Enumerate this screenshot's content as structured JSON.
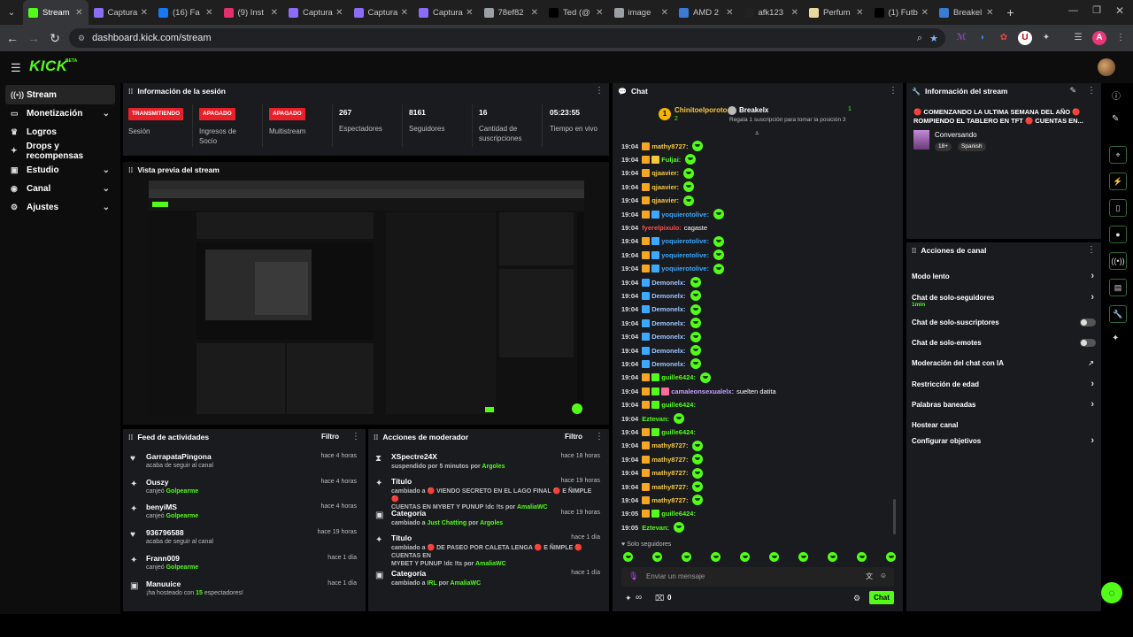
{
  "browser": {
    "tabs": [
      {
        "title": "Stream",
        "icon": "kick-icon",
        "color": "#53fc18",
        "active": true
      },
      {
        "title": "Captura",
        "icon": "capture-icon",
        "color": "#8b6cf6"
      },
      {
        "title": "(16) Fa",
        "icon": "facebook-icon",
        "color": "#1877f2"
      },
      {
        "title": "(9) Inst",
        "icon": "instagram-icon",
        "color": "#e1306c"
      },
      {
        "title": "Captura",
        "icon": "capture-icon",
        "color": "#8b6cf6"
      },
      {
        "title": "Captura",
        "icon": "capture-icon",
        "color": "#8b6cf6"
      },
      {
        "title": "Captura",
        "icon": "capture-icon",
        "color": "#8b6cf6"
      },
      {
        "title": "78ef82",
        "icon": "globe-icon",
        "color": "#9aa0a6"
      },
      {
        "title": "Ted (@",
        "icon": "x-icon",
        "color": "#000000"
      },
      {
        "title": "image",
        "icon": "globe-icon",
        "color": "#9aa0a6"
      },
      {
        "title": "AMD 2",
        "icon": "amd-icon",
        "color": "#3a7bd5"
      },
      {
        "title": "afk123",
        "icon": "tiktok-icon",
        "color": "#222222"
      },
      {
        "title": "Perfum",
        "icon": "perfume-icon",
        "color": "#e8d9a0"
      },
      {
        "title": "(1) Futb",
        "icon": "x-icon",
        "color": "#000000"
      },
      {
        "title": "Breakel",
        "icon": "translate-icon",
        "color": "#3a7bd5"
      }
    ],
    "url": "dashboard.kick.com/stream"
  },
  "brand": {
    "logo": "KICK",
    "beta": "BETA",
    "accent": "#53fc18"
  },
  "sidebar": {
    "items": [
      {
        "label": "Stream",
        "icon": "stream-icon",
        "active": true,
        "chevron": false
      },
      {
        "label": "Monetización",
        "icon": "money-icon",
        "chevron": true
      },
      {
        "label": "Logros",
        "icon": "trophy-icon",
        "chevron": false
      },
      {
        "label": "Drops y recompensas",
        "icon": "gift-icon",
        "chevron": false
      },
      {
        "label": "Estudio",
        "icon": "studio-icon",
        "chevron": true
      },
      {
        "label": "Canal",
        "icon": "channel-icon",
        "chevron": true
      },
      {
        "label": "Ajustes",
        "icon": "gear-icon",
        "chevron": true
      }
    ]
  },
  "session": {
    "title": "Información de la sesión",
    "badges": [
      "TRANSMITIENDO",
      "APAGADO",
      "APAGADO"
    ],
    "labels": [
      "Sesión",
      "Ingresos de Socio",
      "Multistream"
    ],
    "stats": [
      {
        "value": "267",
        "label": "Espectadores"
      },
      {
        "value": "8161",
        "label": "Seguidores"
      },
      {
        "value": "16",
        "label": "Cantidad de suscripciones"
      },
      {
        "value": "05:23:55",
        "label": "Tiempo en vivo"
      }
    ]
  },
  "preview": {
    "title": "Vista previa del stream"
  },
  "activity": {
    "title": "Feed de actividades",
    "filter": "Filtro",
    "items": [
      {
        "icon": "heart-icon",
        "name": "GarrapataPingona",
        "sub": "acaba de seguir al canal",
        "highlight": "",
        "time": "hace 4 horas"
      },
      {
        "icon": "gift-icon",
        "name": "Ouszy",
        "sub": "canjeó",
        "highlight": "Golpearme",
        "time": "hace 4 horas"
      },
      {
        "icon": "gift-icon",
        "name": "benyiMS",
        "sub": "canjeó",
        "highlight": "Golpearme",
        "time": "hace 4 horas"
      },
      {
        "icon": "heart-icon",
        "name": "936796588",
        "sub": "acaba de seguir al canal",
        "highlight": "",
        "time": "hace 19 horas"
      },
      {
        "icon": "gift-icon",
        "name": "Frann009",
        "sub": "canjeó",
        "highlight": "Golpearme",
        "time": "hace 1 día"
      },
      {
        "icon": "host-icon",
        "name": "Manuuice",
        "sub": "¡ha hosteado con",
        "highlight": "15",
        "sub2": "espectadores!",
        "time": "hace 1 día"
      }
    ]
  },
  "modactions": {
    "title": "Acciones de moderador",
    "filter": "Filtro",
    "items": [
      {
        "icon": "hourglass-icon",
        "name": "XSpectre24X",
        "l1": "suspendido por 5 minutos por",
        "who": "Argoles",
        "l2": "",
        "time": "hace 18 horas"
      },
      {
        "icon": "title-icon",
        "name": "Título",
        "l1": "cambiado a 🔴 VIENDO SECRETO EN EL LAGO FINAL 🔴 E ÑIMPLE 🔴",
        "l2": "CUENTAS EN MYBET Y PUNUP !dc !ts por",
        "who": "AmaliaWC",
        "time": "hace 19 horas"
      },
      {
        "icon": "category-icon",
        "name": "Categoría",
        "l1": "cambiado a",
        "who": "Just Chatting",
        "l1b": "por",
        "who2": "Argoles",
        "l2": "",
        "time": "hace 19 horas"
      },
      {
        "icon": "title-icon",
        "name": "Título",
        "l1": "cambiado a 🔴 DE PASEO POR CALETA LENGA 🔴 E ÑIMPLE 🔴 CUENTAS EN",
        "l2": "MYBET Y PUNUP !dc !ts por",
        "who": "AmaliaWC",
        "time": "hace 1 día"
      },
      {
        "icon": "category-icon",
        "name": "Categoría",
        "l1": "cambiado a",
        "who": "IRL",
        "l1b": "por",
        "who2": "AmaliaWC",
        "l2": "",
        "time": "hace 1 día"
      }
    ]
  },
  "chat": {
    "title": "Chat",
    "pinned": {
      "rank": "1",
      "user": "Chinitoelporoto",
      "count": "2",
      "target": "Breakelx",
      "target_count": "1",
      "note": "Regala 1 suscripción para tomar la posición 3"
    },
    "messages": [
      {
        "time": "19:04",
        "user": "mathy8727:",
        "color": "#f5c842",
        "badges": [
          "#f5a623"
        ],
        "text": "",
        "emote": true
      },
      {
        "time": "19:04",
        "user": "Fuljai:",
        "color": "#53fc18",
        "badges": [
          "#f5a623",
          "#f5c842"
        ],
        "text": "",
        "emote": true
      },
      {
        "time": "19:04",
        "user": "qjaavier:",
        "color": "#f5c842",
        "badges": [
          "#f5a623"
        ],
        "text": "",
        "emote": true
      },
      {
        "time": "19:04",
        "user": "qjaavier:",
        "color": "#f5c842",
        "badges": [
          "#f5a623"
        ],
        "text": "",
        "emote": true
      },
      {
        "time": "19:04",
        "user": "qjaavier:",
        "color": "#f5c842",
        "badges": [
          "#f5a623"
        ],
        "text": "",
        "emote": true
      },
      {
        "time": "19:04",
        "user": "yoquierotolive:",
        "color": "#3ba9ff",
        "badges": [
          "#f5a623",
          "#3ba9ff"
        ],
        "text": "",
        "emote": true
      },
      {
        "time": "19:04",
        "user": "fyerelpixulo:",
        "color": "#ff4d4d",
        "badges": [],
        "text": "cagaste",
        "emote": false
      },
      {
        "time": "19:04",
        "user": "yoquierotolive:",
        "color": "#3ba9ff",
        "badges": [
          "#f5a623",
          "#3ba9ff"
        ],
        "text": "",
        "emote": true
      },
      {
        "time": "19:04",
        "user": "yoquierotolive:",
        "color": "#3ba9ff",
        "badges": [
          "#f5a623",
          "#3ba9ff"
        ],
        "text": "",
        "emote": true
      },
      {
        "time": "19:04",
        "user": "yoquierotolive:",
        "color": "#3ba9ff",
        "badges": [
          "#f5a623",
          "#3ba9ff"
        ],
        "text": "",
        "emote": true
      },
      {
        "time": "19:04",
        "user": "Demonelx:",
        "color": "#9ec5ff",
        "badges": [
          "#3ba9ff"
        ],
        "text": "",
        "emote": true
      },
      {
        "time": "19:04",
        "user": "Demonelx:",
        "color": "#9ec5ff",
        "badges": [
          "#3ba9ff"
        ],
        "text": "",
        "emote": true
      },
      {
        "time": "19:04",
        "user": "Demonelx:",
        "color": "#9ec5ff",
        "badges": [
          "#3ba9ff"
        ],
        "text": "",
        "emote": true
      },
      {
        "time": "19:04",
        "user": "Demonelx:",
        "color": "#9ec5ff",
        "badges": [
          "#3ba9ff"
        ],
        "text": "",
        "emote": true
      },
      {
        "time": "19:04",
        "user": "Demonelx:",
        "color": "#9ec5ff",
        "badges": [
          "#3ba9ff"
        ],
        "text": "",
        "emote": true
      },
      {
        "time": "19:04",
        "user": "Demonelx:",
        "color": "#9ec5ff",
        "badges": [
          "#3ba9ff"
        ],
        "text": "",
        "emote": true
      },
      {
        "time": "19:04",
        "user": "Demonelx:",
        "color": "#9ec5ff",
        "badges": [
          "#3ba9ff"
        ],
        "text": "",
        "emote": true
      },
      {
        "time": "19:04",
        "user": "guille6424:",
        "color": "#53fc18",
        "badges": [
          "#f5a623",
          "#53fc18"
        ],
        "text": "",
        "emote": true
      },
      {
        "time": "19:04",
        "user": "camaleonsexualelx:",
        "color": "#c8a2ff",
        "badges": [
          "#f5a623",
          "#53fc18",
          "#ff6b9a"
        ],
        "text": "suelten datita",
        "emote": false
      },
      {
        "time": "19:04",
        "user": "guille6424:",
        "color": "#53fc18",
        "badges": [
          "#f5a623",
          "#53fc18"
        ],
        "text": "",
        "emote": false
      },
      {
        "time": "19:04",
        "user": "Eztevan:",
        "color": "#53fc18",
        "badges": [],
        "text": "",
        "emote": true
      },
      {
        "time": "19:04",
        "user": "guille6424:",
        "color": "#53fc18",
        "badges": [
          "#f5a623",
          "#53fc18"
        ],
        "text": "",
        "emote": false
      },
      {
        "time": "19:04",
        "user": "mathy8727:",
        "color": "#f5c842",
        "badges": [
          "#f5a623"
        ],
        "text": "",
        "emote": true
      },
      {
        "time": "19:04",
        "user": "mathy8727:",
        "color": "#f5c842",
        "badges": [
          "#f5a623"
        ],
        "text": "",
        "emote": true
      },
      {
        "time": "19:04",
        "user": "mathy8727:",
        "color": "#f5c842",
        "badges": [
          "#f5a623"
        ],
        "text": "",
        "emote": true
      },
      {
        "time": "19:04",
        "user": "mathy8727:",
        "color": "#f5c842",
        "badges": [
          "#f5a623"
        ],
        "text": "",
        "emote": true
      },
      {
        "time": "19:04",
        "user": "mathy8727:",
        "color": "#f5c842",
        "badges": [
          "#f5a623"
        ],
        "text": "",
        "emote": true
      },
      {
        "time": "19:05",
        "user": "guille6424:",
        "color": "#53fc18",
        "badges": [
          "#f5a623",
          "#53fc18"
        ],
        "text": "",
        "emote": false
      },
      {
        "time": "19:05",
        "user": "Eztevan:",
        "color": "#53fc18",
        "badges": [],
        "text": "",
        "emote": true
      }
    ],
    "followers_only": "Solo seguidores",
    "placeholder": "Enviar un mensaje",
    "infinity": "∞",
    "gift_count": "0",
    "send": "Chat"
  },
  "streaminfo": {
    "title": "Información del stream",
    "stream_title": "🔴 COMENZANDO LA ULTIMA SEMANA DEL AÑO 🔴 ROMPIENDO EL TABLERO EN TFT 🔴 CUENTAS EN...",
    "category": "Conversando",
    "tags": [
      "18+",
      "Spanish"
    ]
  },
  "channel_actions": {
    "title": "Acciones de canal",
    "items": [
      {
        "label": "Modo lento",
        "sub": "",
        "control": "chevron"
      },
      {
        "label": "Chat de solo-seguidores",
        "sub": "1min",
        "control": "chevron"
      },
      {
        "label": "Chat de solo-suscriptores",
        "sub": "",
        "control": "toggle"
      },
      {
        "label": "Chat de solo-emotes",
        "sub": "",
        "control": "toggle"
      },
      {
        "label": "Moderación del chat con IA",
        "sub": "",
        "control": "external"
      },
      {
        "label": "Restricción de edad",
        "sub": "",
        "control": "chevron"
      },
      {
        "label": "Palabras baneadas",
        "sub": "",
        "control": "chevron"
      },
      {
        "label": "Hostear canal",
        "sub": "",
        "control": "none"
      },
      {
        "label": "Configurar objetivos",
        "sub": "",
        "control": "chevron"
      }
    ]
  }
}
